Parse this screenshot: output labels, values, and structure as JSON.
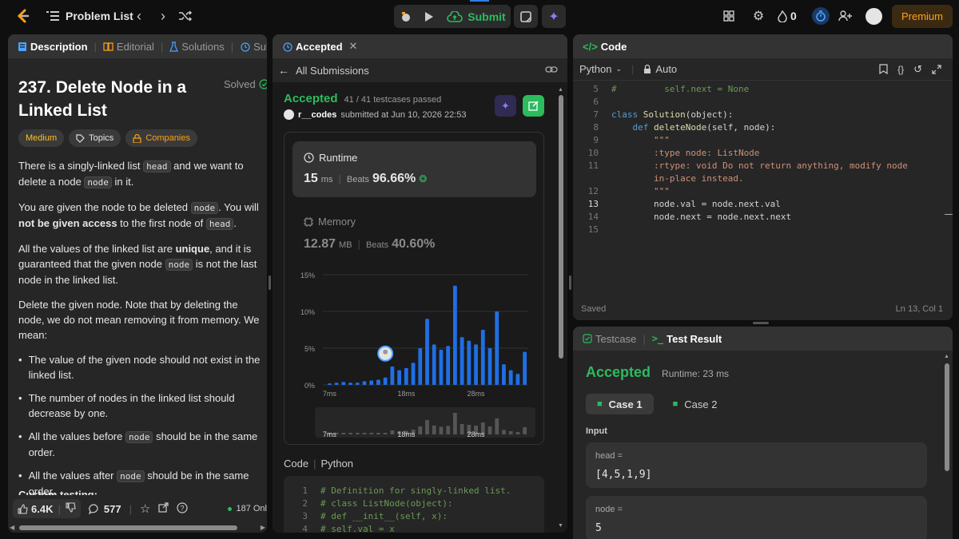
{
  "topbar": {
    "problem_list": "Problem List",
    "submit": "Submit",
    "streak": "0",
    "premium": "Premium"
  },
  "left": {
    "tabs": [
      "Description",
      "Editorial",
      "Solutions",
      "Subm"
    ],
    "title_line1": "237. Delete Node in a",
    "title_line2": "Linked List",
    "solved": "Solved",
    "difficulty": "Medium",
    "topics": "Topics",
    "companies": "Companies",
    "p1": {
      "a": "There is a singly-linked list ",
      "c1": "head",
      "b": " and we want to delete a node ",
      "c2": "node",
      "c": " in it."
    },
    "p2": {
      "a": "You are given the node to be deleted ",
      "c1": "node",
      "b": ". You will ",
      "strong": "not be given access",
      "c": " to the first node of ",
      "c2": "head",
      "d": "."
    },
    "p3": {
      "a": "All the values of the linked list are ",
      "strong": "unique",
      "b": ", and it is guaranteed that the given node ",
      "c1": "node",
      "c": " is not the last node in the linked list."
    },
    "p4": "Delete the given node. Note that by deleting the node, we do not mean removing it from memory. We mean:",
    "bullets": [
      {
        "text": "The value of the given node should not exist in the linked list.",
        "code": "",
        "rest": ""
      },
      {
        "text": "The number of nodes in the linked list should decrease by one.",
        "code": "",
        "rest": ""
      },
      {
        "text": "All the values before ",
        "code": "node",
        "rest": " should be in the same order."
      },
      {
        "text": "All the values after ",
        "code": "node",
        "rest": " should be in the same order."
      }
    ],
    "cut_heading": "Custom testing:",
    "likes": "6.4K",
    "comments": "577",
    "online": "187 Onl"
  },
  "middle": {
    "tab": "Accepted",
    "all_submissions": "All Submissions",
    "status": "Accepted",
    "testcases": "41 / 41 testcases passed",
    "user": "r__codes",
    "submitted": "submitted at Jun 10, 2026 22:53",
    "runtime_label": "Runtime",
    "runtime_value": "15",
    "runtime_unit": "ms",
    "runtime_beats_label": "Beats",
    "runtime_beats": "96.66%",
    "memory_label": "Memory",
    "memory_value": "12.87",
    "memory_unit": "MB",
    "memory_beats_label": "Beats",
    "memory_beats": "40.60%",
    "code_label": "Code",
    "code_lang": "Python",
    "code_lines": [
      {
        "n": "1",
        "t": "# Definition for singly-linked list."
      },
      {
        "n": "2",
        "t": "# class ListNode(object):"
      },
      {
        "n": "3",
        "t": "#     def __init__(self, x):"
      },
      {
        "n": "4",
        "t": "#         self.val = x"
      }
    ]
  },
  "chart_data": {
    "type": "bar",
    "ylim": [
      0,
      15
    ],
    "yticks": [
      "15%",
      "10%",
      "5%",
      "0%"
    ],
    "xticks": [
      "7ms",
      "18ms",
      "28ms"
    ],
    "values": [
      0.2,
      0.3,
      0.4,
      0.3,
      0.3,
      0.5,
      0.6,
      0.7,
      1.0,
      2.5,
      2.0,
      2.3,
      3.0,
      5.0,
      9.0,
      5.5,
      4.8,
      5.3,
      13.5,
      6.5,
      6.0,
      5.5,
      7.5,
      5.0,
      10.0,
      2.8,
      2.0,
      1.5,
      4.5
    ],
    "highlight_index": 8
  },
  "right": {
    "code_tab": "Code",
    "lang": "Python",
    "auto": "Auto",
    "saved": "Saved",
    "cursor": "Ln 13, Col 1",
    "lines": [
      {
        "n": "5",
        "segs": [
          [
            "cm",
            "#         self.next = None"
          ]
        ]
      },
      {
        "n": "6",
        "segs": []
      },
      {
        "n": "7",
        "segs": [
          [
            "kw",
            "class "
          ],
          [
            "fn",
            "Solution"
          ],
          [
            "pl",
            "(object):"
          ]
        ]
      },
      {
        "n": "8",
        "segs": [
          [
            "pl",
            "    "
          ],
          [
            "kw",
            "def "
          ],
          [
            "fn",
            "deleteNode"
          ],
          [
            "pl",
            "(self, node):"
          ]
        ]
      },
      {
        "n": "9",
        "segs": [
          [
            "str",
            "        \"\"\""
          ]
        ]
      },
      {
        "n": "10",
        "segs": [
          [
            "str",
            "        :type node: ListNode"
          ]
        ]
      },
      {
        "n": "11",
        "segs": [
          [
            "str",
            "        :rtype: void Do not return anything, modify node"
          ]
        ]
      },
      {
        "n": "",
        "segs": [
          [
            "str",
            "        in-place instead."
          ]
        ]
      },
      {
        "n": "12",
        "segs": [
          [
            "str",
            "        \"\"\""
          ]
        ]
      },
      {
        "n": "13",
        "segs": [
          [
            "pl",
            "        node.val = node.next.val"
          ]
        ]
      },
      {
        "n": "14",
        "segs": [
          [
            "pl",
            "        node.next = node.next.next"
          ]
        ]
      },
      {
        "n": "15",
        "segs": []
      }
    ],
    "testcase_tab": "Testcase",
    "result_tab": "Test Result",
    "result_status": "Accepted",
    "result_runtime": "Runtime: 23 ms",
    "case1": "Case 1",
    "case2": "Case 2",
    "input_label": "Input",
    "head_label": "head =",
    "head_value": "[4,5,1,9]",
    "node_label": "node =",
    "node_value": "5"
  }
}
